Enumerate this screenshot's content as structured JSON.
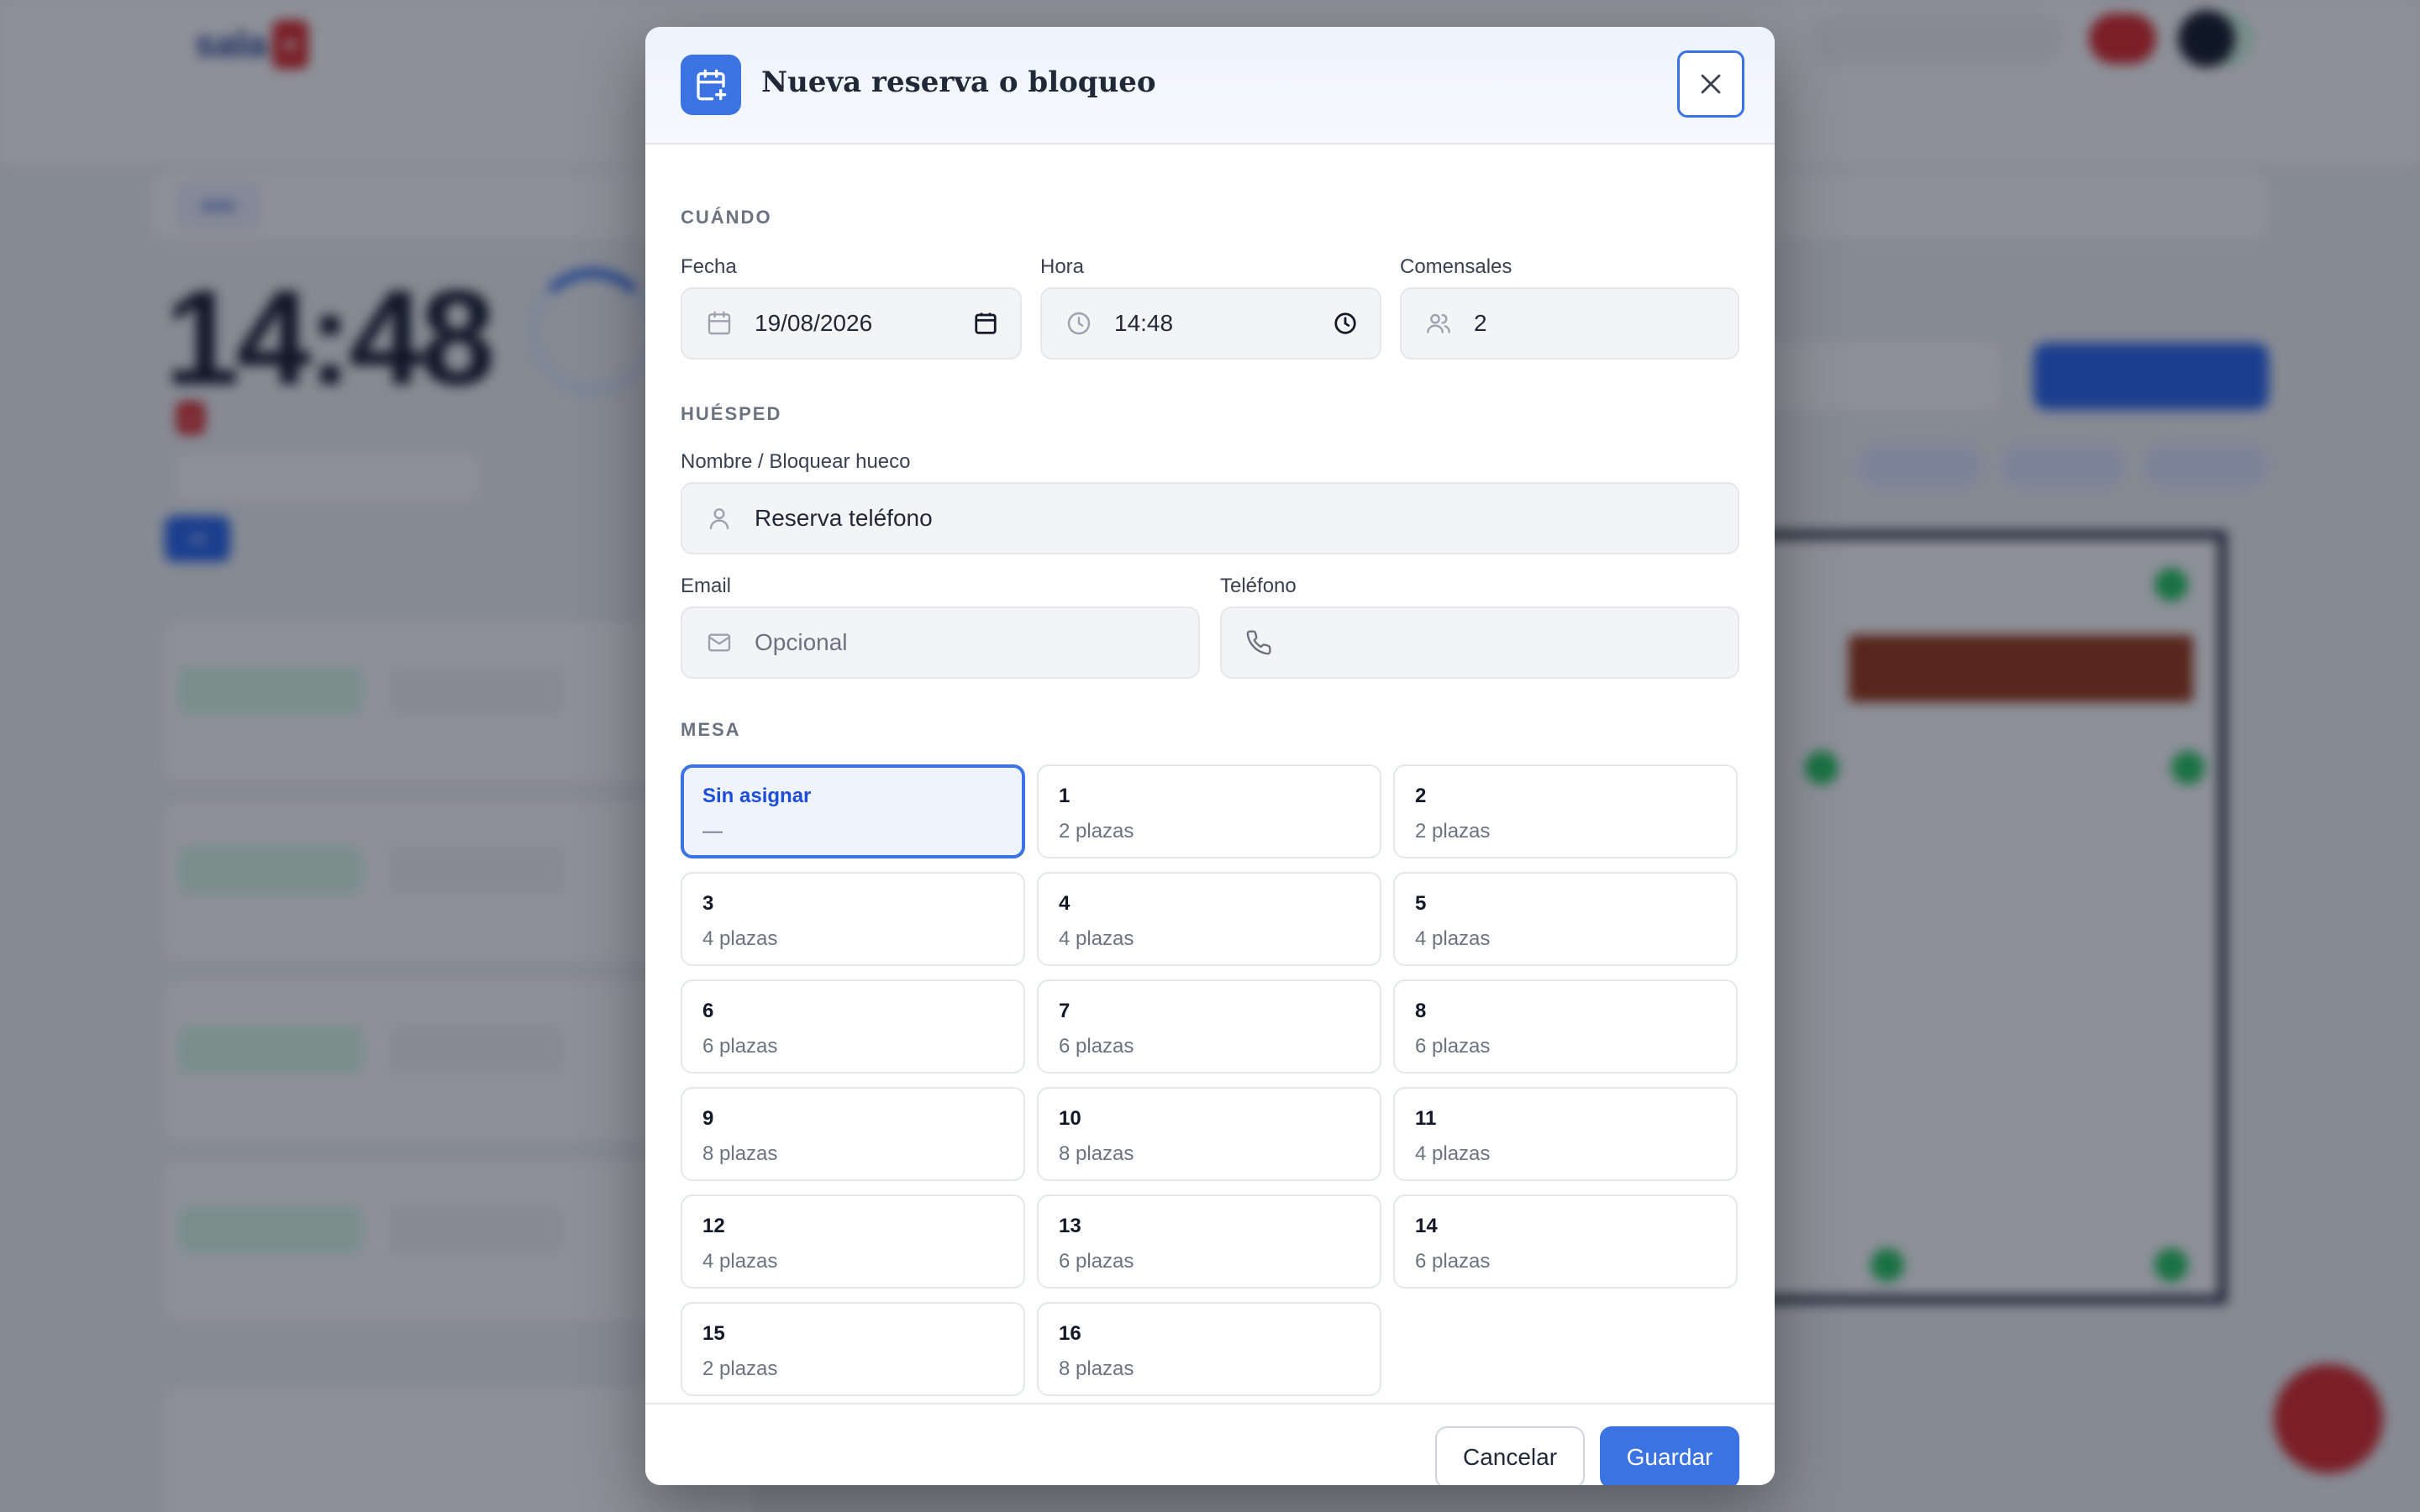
{
  "modal": {
    "title": "Nueva reserva o bloqueo",
    "header_icon": "calendar-plus-icon",
    "when": {
      "section_title": "CUÁNDO",
      "date_label": "Fecha",
      "date_value": "19/08/2026",
      "time_label": "Hora",
      "time_value": "14:48",
      "guests_label": "Comensales",
      "guests_value": "2"
    },
    "guest": {
      "section_title": "HUÉSPED",
      "name_label": "Nombre / Bloquear hueco",
      "name_value": "Reserva teléfono",
      "email_label": "Email",
      "email_placeholder": "Opcional",
      "phone_label": "Teléfono",
      "phone_value": ""
    },
    "table": {
      "section_title": "MESA",
      "options": [
        {
          "name": "Sin asignar",
          "sub": "—",
          "selected": true
        },
        {
          "name": "1",
          "sub": "2 plazas"
        },
        {
          "name": "2",
          "sub": "2 plazas"
        },
        {
          "name": "3",
          "sub": "4 plazas"
        },
        {
          "name": "4",
          "sub": "4 plazas"
        },
        {
          "name": "5",
          "sub": "4 plazas"
        },
        {
          "name": "6",
          "sub": "6 plazas"
        },
        {
          "name": "7",
          "sub": "6 plazas"
        },
        {
          "name": "8",
          "sub": "6 plazas"
        },
        {
          "name": "9",
          "sub": "8 plazas"
        },
        {
          "name": "10",
          "sub": "8 plazas"
        },
        {
          "name": "11",
          "sub": "4 plazas"
        },
        {
          "name": "12",
          "sub": "4 plazas"
        },
        {
          "name": "13",
          "sub": "6 plazas"
        },
        {
          "name": "14",
          "sub": "6 plazas"
        },
        {
          "name": "15",
          "sub": "2 plazas"
        },
        {
          "name": "16",
          "sub": "8 plazas"
        }
      ]
    },
    "footer": {
      "cancel_label": "Cancelar",
      "save_label": "Guardar"
    }
  },
  "background": {
    "clock": "14:48"
  },
  "colors": {
    "accent": "#3b73e3",
    "selected_bg": "#eef3fd",
    "overlay": "rgba(17,24,39,0.48)"
  }
}
